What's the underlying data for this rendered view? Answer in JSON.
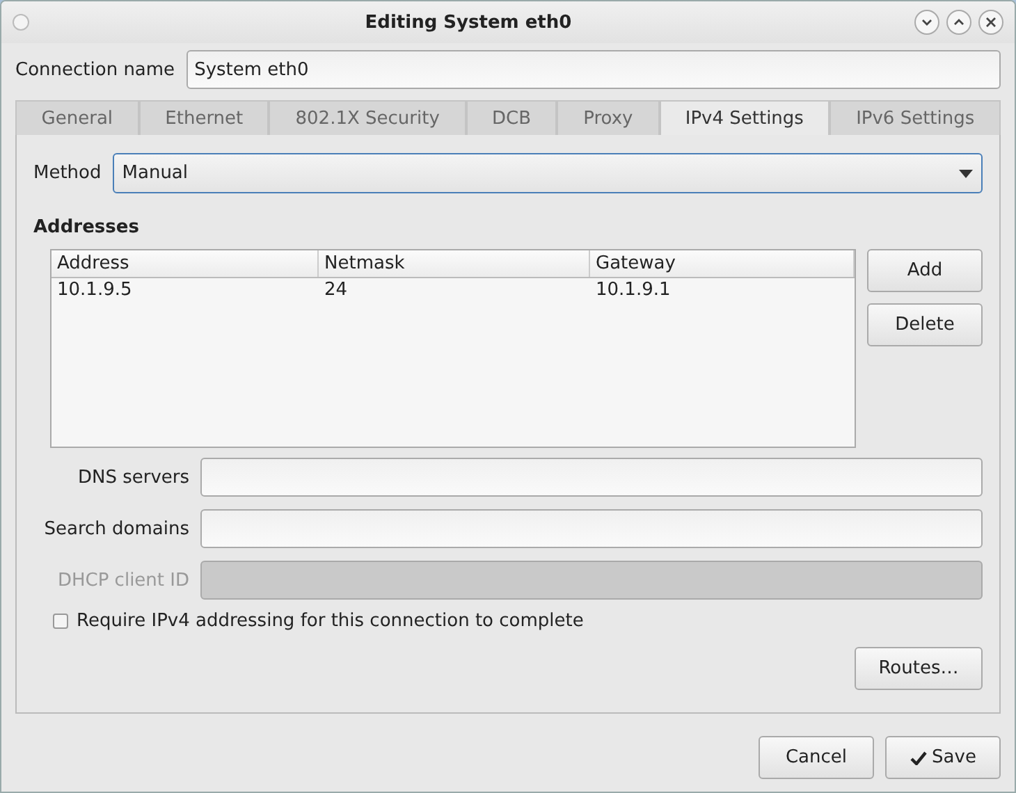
{
  "window": {
    "title": "Editing System eth0"
  },
  "connection_name": {
    "label": "Connection name",
    "value": "System eth0"
  },
  "tabs": [
    {
      "label": "General",
      "selected": false
    },
    {
      "label": "Ethernet",
      "selected": false
    },
    {
      "label": "802.1X Security",
      "selected": false
    },
    {
      "label": "DCB",
      "selected": false
    },
    {
      "label": "Proxy",
      "selected": false
    },
    {
      "label": "IPv4 Settings",
      "selected": true
    },
    {
      "label": "IPv6 Settings",
      "selected": false
    }
  ],
  "method": {
    "label": "Method",
    "value": "Manual"
  },
  "addresses": {
    "title": "Addresses",
    "columns": [
      "Address",
      "Netmask",
      "Gateway"
    ],
    "rows": [
      [
        "10.1.9.5",
        "24",
        "10.1.9.1"
      ]
    ],
    "buttons": [
      "Add",
      "Delete"
    ]
  },
  "fields": [
    {
      "label": "DNS servers",
      "disabled": false
    },
    {
      "label": "Search domains",
      "disabled": false
    },
    {
      "label": "DHCP client ID",
      "disabled": true
    }
  ],
  "require_checkbox": {
    "label": "Require IPv4 addressing for this connection to complete",
    "checked": false
  },
  "routes_button": "Routes…",
  "footer_buttons": [
    {
      "kind": "plain",
      "label": "Cancel"
    },
    {
      "kind": "confirm",
      "label": "Save"
    }
  ]
}
